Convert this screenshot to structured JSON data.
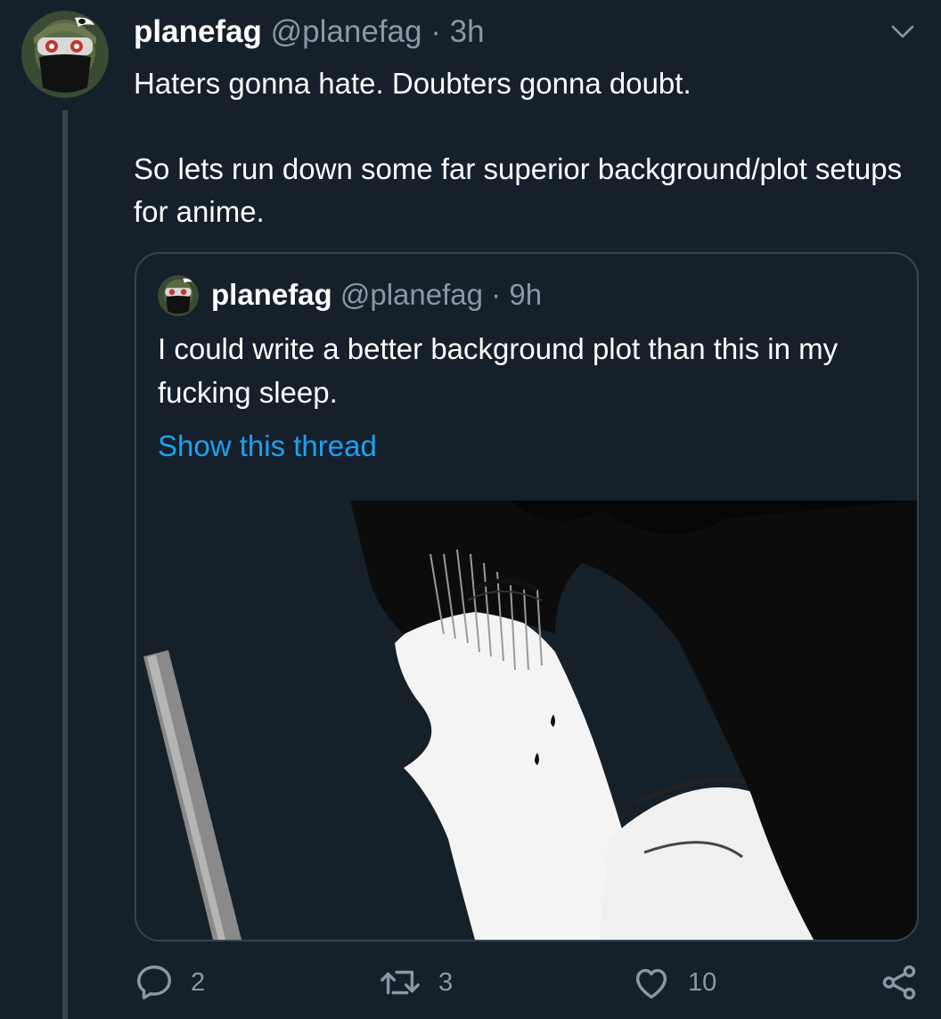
{
  "tweet": {
    "display_name": "planefag",
    "handle": "@planefag",
    "separator": "·",
    "time": "3h",
    "avatar_icon": "masked-soldier-avatar",
    "text_line1": "Haters gonna hate. Doubters gonna doubt.",
    "text_line2": "So lets run down some far superior background/plot setups for anime.",
    "menu_icon": "chevron-down-icon"
  },
  "quoted": {
    "display_name": "planefag",
    "handle": "@planefag",
    "separator": "·",
    "time": "9h",
    "text": "I could write a better background plot than this in my fucking sleep.",
    "show_thread": "Show this thread",
    "image_icon": "manga-panel-image"
  },
  "actions": {
    "reply_count": "2",
    "retweet_count": "3",
    "like_count": "10"
  },
  "colors": {
    "background": "#15202b",
    "border": "#38444d",
    "muted": "#8899a6",
    "link": "#1da1f2"
  }
}
